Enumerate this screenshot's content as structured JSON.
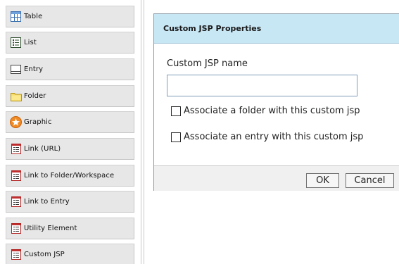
{
  "palette": {
    "items": [
      {
        "label": "Table",
        "icon": "table-icon"
      },
      {
        "label": "List",
        "icon": "list-icon"
      },
      {
        "label": "Entry",
        "icon": "entry-icon"
      },
      {
        "label": "Folder",
        "icon": "folder-icon"
      },
      {
        "label": "Graphic",
        "icon": "graphic-icon"
      },
      {
        "label": "Link (URL)",
        "icon": "link-icon"
      },
      {
        "label": "Link to Folder/Workspace",
        "icon": "link-icon"
      },
      {
        "label": "Link to Entry",
        "icon": "link-icon"
      },
      {
        "label": "Utility Element",
        "icon": "link-icon"
      },
      {
        "label": "Custom JSP",
        "icon": "link-icon"
      }
    ]
  },
  "dialog": {
    "title": "Custom JSP Properties",
    "name_label": "Custom JSP name",
    "name_value": "",
    "associate_folder_label": "Associate a folder with this custom jsp",
    "associate_folder_checked": false,
    "associate_entry_label": "Associate an entry with this custom jsp",
    "associate_entry_checked": false,
    "ok_label": "OK",
    "cancel_label": "Cancel"
  },
  "colors": {
    "header_bg": "#c8e7f5",
    "palette_bg": "#e7e7e7",
    "footer_bg": "#f0f0f0"
  }
}
